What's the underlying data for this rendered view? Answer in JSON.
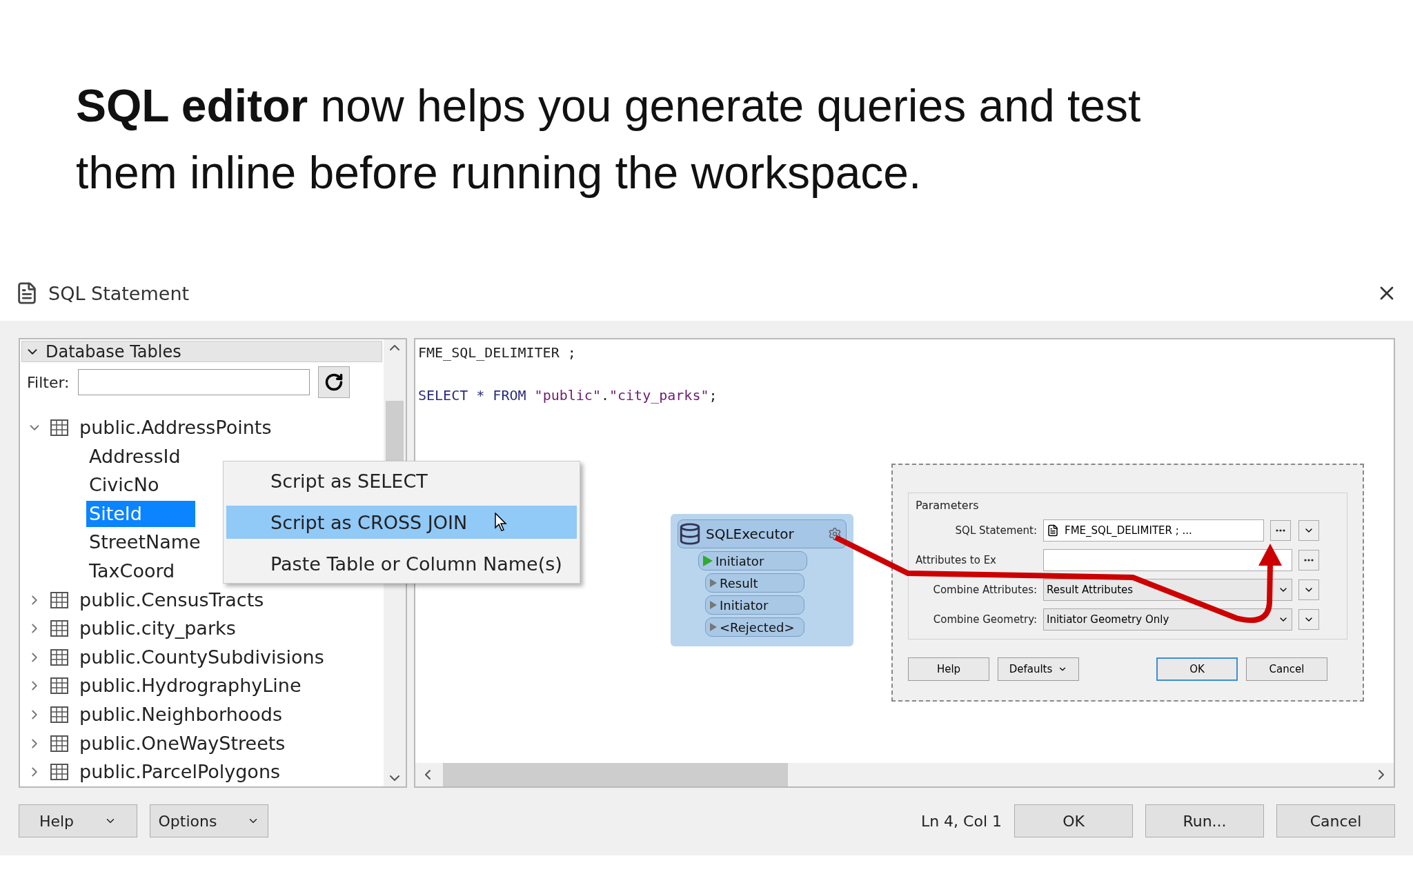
{
  "heading": "**SQL editor** now helps you generate queries and test them inline before running the workspace.",
  "dialog": {
    "title": "SQL Statement"
  },
  "tables_panel": {
    "header": "Database Tables",
    "expanded": true,
    "filter_label": "Filter:",
    "tree": [
      {
        "label": "public.AddressPoints",
        "expanded": true,
        "children": [
          {
            "label": "AddressId",
            "selected": false
          },
          {
            "label": "CivicNo",
            "selected": false
          },
          {
            "label": "SiteId",
            "selected": true
          },
          {
            "label": "StreetName",
            "selected": false
          },
          {
            "label": "TaxCoord",
            "selected": false
          }
        ]
      },
      {
        "label": "public.CensusTracts",
        "expanded": false
      },
      {
        "label": "public.city_parks",
        "expanded": false
      },
      {
        "label": "public.CountySubdivisions",
        "expanded": false
      },
      {
        "label": "public.HydrographyLine",
        "expanded": false
      },
      {
        "label": "public.Neighborhoods",
        "expanded": false
      },
      {
        "label": "public.OneWayStreets",
        "expanded": false
      },
      {
        "label": "public.ParcelPolygons",
        "expanded": false
      }
    ]
  },
  "context_menu": [
    {
      "label": "Script as SELECT",
      "selected": false
    },
    {
      "label": "Script as CROSS JOIN",
      "selected": true
    },
    {
      "label": "Paste Table or Column Name(s)",
      "selected": false
    }
  ],
  "editor": {
    "lines": [
      [
        {
          "text": "FME_SQL_DELIMITER ;",
          "kind": "plain"
        }
      ],
      [
        {
          "text": "SELECT * FROM",
          "kind": "keyword"
        },
        {
          "text": " \"public\"",
          "kind": "string"
        },
        {
          "text": ".",
          "kind": "plain"
        },
        {
          "text": "\"city_parks\"",
          "kind": "string"
        },
        {
          "text": ";",
          "kind": "plain"
        }
      ]
    ]
  },
  "inset": {
    "node": {
      "title": "SQLExecutor",
      "input": "Initiator",
      "outputs": [
        "Result",
        "Initiator",
        "<Rejected>"
      ]
    },
    "parameters": {
      "group": "Parameters",
      "rows": [
        {
          "label": "SQL Statement:",
          "value": "FME_SQL_DELIMITER ; ...",
          "kind": "editor"
        },
        {
          "label": "Attributes to Ex",
          "kind": "text"
        },
        {
          "label": "Combine Attributes:",
          "value": "Result Attributes",
          "kind": "dropdown"
        },
        {
          "label": "Combine Geometry:",
          "value": "Initiator Geometry Only",
          "kind": "dropdown"
        }
      ],
      "buttons": [
        {
          "label": "Help",
          "menu": false,
          "default": false
        },
        {
          "label": "Defaults",
          "menu": true,
          "default": false
        },
        {
          "label": "OK",
          "menu": false,
          "default": true
        },
        {
          "label": "Cancel",
          "menu": false,
          "default": false
        }
      ]
    }
  },
  "bottom_bar": {
    "menu_buttons": [
      "Help",
      "Options"
    ],
    "cursor": "Ln 4, Col 1",
    "buttons": [
      "OK",
      "Run...",
      "Cancel"
    ]
  }
}
